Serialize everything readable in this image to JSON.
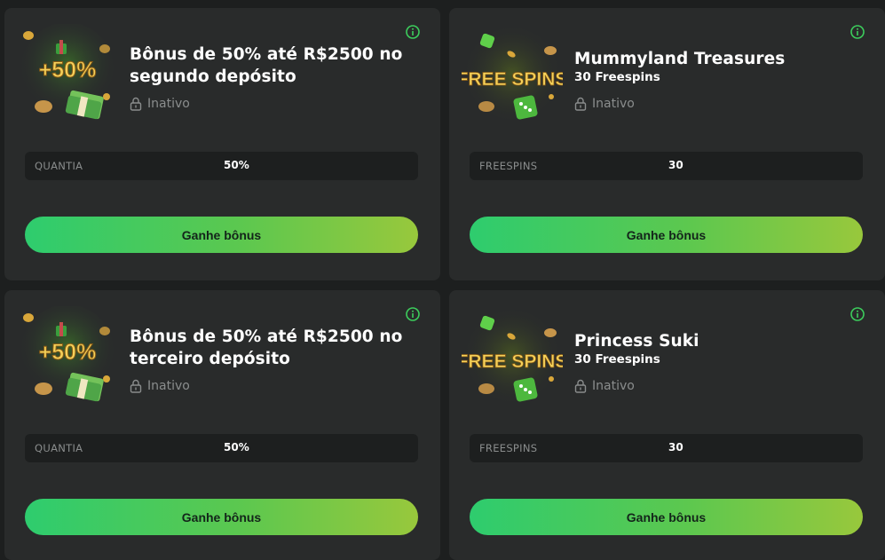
{
  "cards": [
    {
      "art_label": "+50%",
      "title": "Bônus de 50% até R$2500 no segundo depósito",
      "subtitle": "",
      "status": "Inativo",
      "field_label": "QUANTIA",
      "field_value": "50%",
      "button": "Ganhe bônus"
    },
    {
      "art_label": "FREE SPINS",
      "title": "Mummyland Treasures",
      "subtitle": "30 Freespins",
      "status": "Inativo",
      "field_label": "FREESPINS",
      "field_value": "30",
      "button": "Ganhe bônus"
    },
    {
      "art_label": "+50%",
      "title": "Bônus de 50% até R$2500 no terceiro depósito",
      "subtitle": "",
      "status": "Inativo",
      "field_label": "QUANTIA",
      "field_value": "50%",
      "button": "Ganhe bônus"
    },
    {
      "art_label": "FREE SPINS",
      "title": "Princess Suki",
      "subtitle": "30 Freespins",
      "status": "Inativo",
      "field_label": "FREESPINS",
      "field_value": "30",
      "button": "Ganhe bônus"
    }
  ],
  "colors": {
    "accent_green": "#2ecc6e",
    "accent_lime": "#98c83c",
    "card_bg": "#292b2b",
    "page_bg": "#1d1f1f"
  },
  "icons": {
    "info": "info-icon",
    "lock": "lock-icon",
    "coins": "coin-icon",
    "dice": "dice-icon",
    "money": "money-stack-icon",
    "gift": "gift-icon"
  }
}
